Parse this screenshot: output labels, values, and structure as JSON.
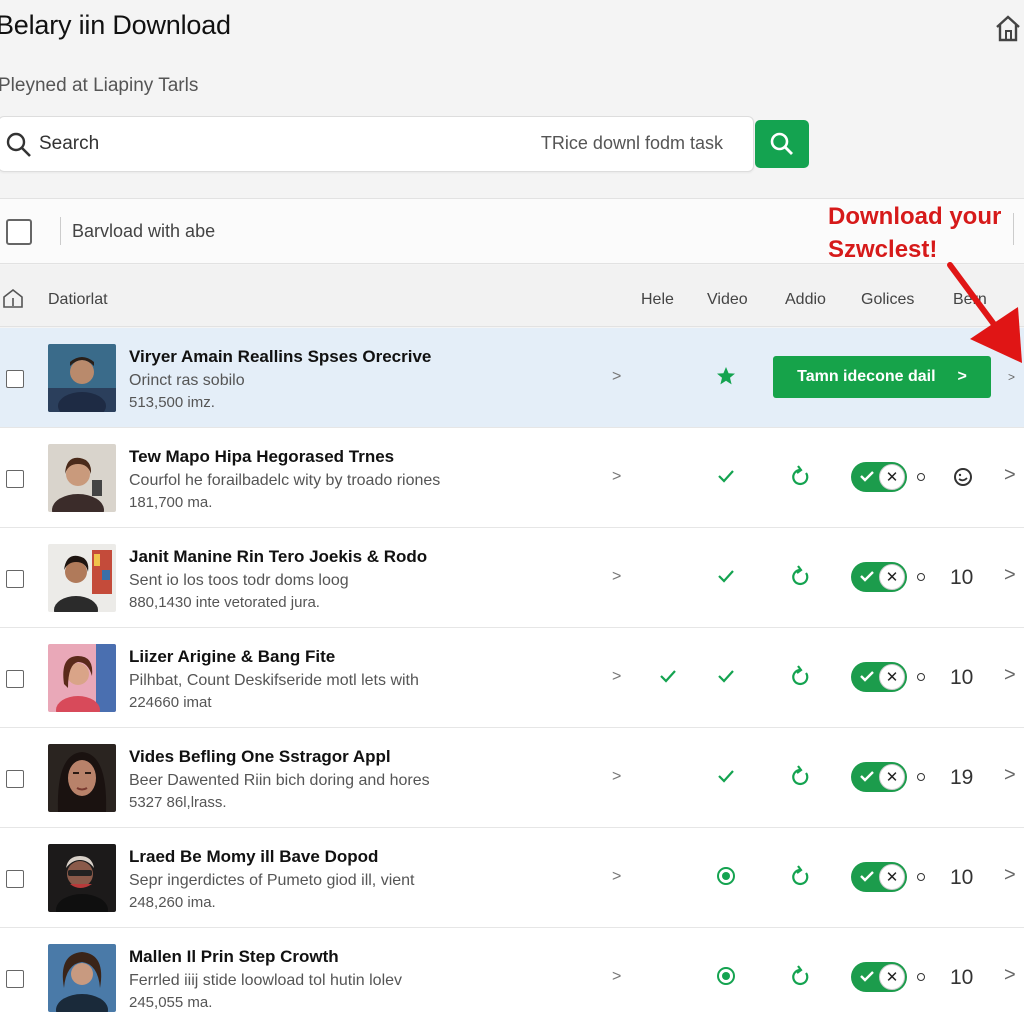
{
  "app": {
    "title": "Belary iin Download",
    "subtitle": "Pleyned at Liapiny Tarls"
  },
  "search": {
    "label": "Search",
    "hint": "TRice downl fodm task"
  },
  "toolbar": {
    "bulk_label": "Barvload with abe"
  },
  "callout": {
    "line1": "Download your",
    "line2": "Szwclest!"
  },
  "columns": {
    "name": "Datiorlat",
    "hele": "Hele",
    "video": "Video",
    "audio": "Addio",
    "golices": "Golices",
    "last": "Bern"
  },
  "cta": {
    "label": "Tamn idecone dail"
  },
  "rows": [
    {
      "title": "Viryer Amain Reallins Spses Orecrive",
      "desc": "Orinct ras sobilo",
      "size": "513,500 imz.",
      "video_icon": "star-icon",
      "selected": true
    },
    {
      "title": "Tew Mapo Hipa Hegorased Trnes",
      "desc": "Courfol he forailbadelc wity by troado riones",
      "size": "181,700 ma.",
      "video_icon": "check-icon",
      "count": ""
    },
    {
      "title": "Janit Manine Rin Tero Joekis & Rodo",
      "desc": "Sent io los toos todr doms loog",
      "size": "880,1430 inte vetorated jura.",
      "video_icon": "check-icon",
      "count": "10"
    },
    {
      "title": "Liizer Arigine & Bang Fite",
      "desc": "Pilhbat, Count Deskifseride motl lets with",
      "size": "224660 imat",
      "hele_icon": "check-icon",
      "video_icon": "check-icon",
      "count": "10"
    },
    {
      "title": "Vides Befling One Sstragor Appl",
      "desc": "Beer Dawented Riin bich doring and hores",
      "size": "5327 86l,lrass.",
      "video_icon": "check-icon",
      "count": "19"
    },
    {
      "title": "Lraed Be Momy ill Bave Dopod",
      "desc": "Sepr ingerdictes of Pumeto giod ill, vient",
      "size": "248,260 ima.",
      "video_icon": "radio-icon",
      "count": "10"
    },
    {
      "title": "Mallen Il Prin Step Crowth",
      "desc": "Ferrled iiij stide loowload tol hutin lolev",
      "size": "245,055 ma.",
      "video_icon": "radio-icon",
      "count": "10"
    }
  ],
  "colors": {
    "accent_green": "#16a34a",
    "callout_red": "#d61a1a",
    "selected_row": "#e4eef8"
  }
}
